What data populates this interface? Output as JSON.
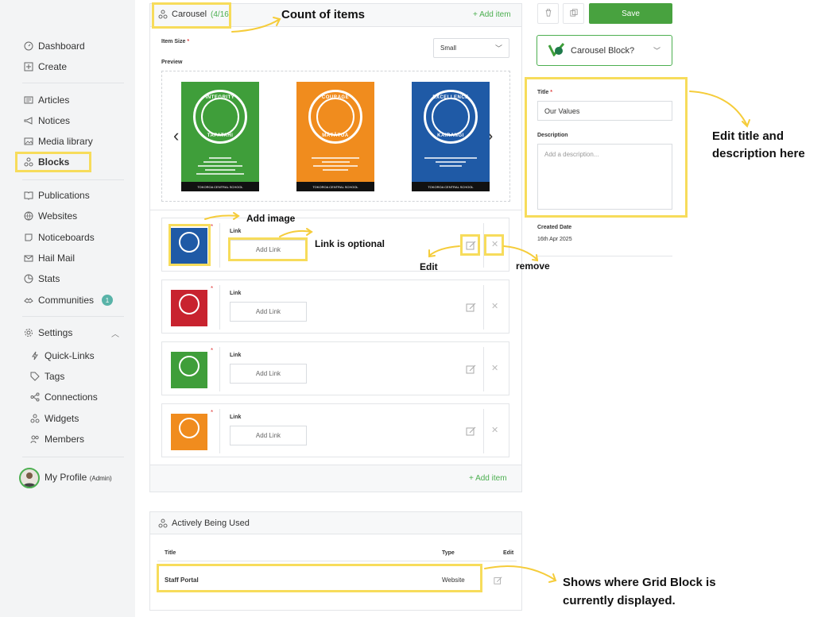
{
  "sidebar": {
    "items": [
      {
        "label": "Dashboard",
        "icon": "dashboard-icon"
      },
      {
        "label": "Create",
        "icon": "plus-square-icon"
      },
      {
        "label": "Articles",
        "icon": "newspaper-icon"
      },
      {
        "label": "Notices",
        "icon": "megaphone-icon"
      },
      {
        "label": "Media library",
        "icon": "image-icon"
      },
      {
        "label": "Blocks",
        "icon": "blocks-icon"
      },
      {
        "label": "Publications",
        "icon": "book-icon"
      },
      {
        "label": "Websites",
        "icon": "globe-icon"
      },
      {
        "label": "Noticeboards",
        "icon": "noticeboard-icon"
      },
      {
        "label": "Hail Mail",
        "icon": "mail-icon"
      },
      {
        "label": "Stats",
        "icon": "chart-icon"
      },
      {
        "label": "Communities",
        "icon": "communities-icon",
        "badge": "1"
      },
      {
        "label": "Settings",
        "icon": "gear-icon"
      },
      {
        "label": "Quick-Links",
        "icon": "lightning-icon"
      },
      {
        "label": "Tags",
        "icon": "tag-icon"
      },
      {
        "label": "Connections",
        "icon": "share-icon"
      },
      {
        "label": "Widgets",
        "icon": "widgets-icon"
      },
      {
        "label": "Members",
        "icon": "users-icon"
      }
    ],
    "profile": {
      "label": "My Profile",
      "role": "(Admin)"
    }
  },
  "carousel": {
    "title": "Carousel",
    "count": "(4/16",
    "add_item": "+ Add item",
    "item_size_label": "Item Size",
    "item_size_value": "Small",
    "preview_label": "Preview",
    "posters": [
      {
        "word_top": "INTEGRITY",
        "word_bot": "TAPATAHI",
        "color": "#3f9e3a",
        "foot": "TOKOROA CENTRAL SCHOOL"
      },
      {
        "word_top": "COURAGE",
        "word_bot": "MĀTĀTOA",
        "color": "#f08c1e",
        "foot": "TOKOROA CENTRAL SCHOOL"
      },
      {
        "word_top": "EXCELLENCE",
        "word_bot": "KAIRANGI",
        "color": "#1f5aa6",
        "foot": "TOKOROA CENTRAL SCHOOL"
      }
    ],
    "items": [
      {
        "color": "#1f5aa6",
        "link_label": "Link",
        "link_button": "Add Link"
      },
      {
        "color": "#c8232f",
        "link_label": "Link",
        "link_button": "Add Link"
      },
      {
        "color": "#3f9e3a",
        "link_label": "Link",
        "link_button": "Add Link"
      },
      {
        "color": "#f08c1e",
        "link_label": "Link",
        "link_button": "Add Link"
      }
    ],
    "add_item_bottom": "+ Add item"
  },
  "usage": {
    "title": "Actively Being Used",
    "columns": {
      "title": "Title",
      "type": "Type",
      "edit": "Edit"
    },
    "rows": [
      {
        "title": "Staff Portal",
        "type": "Website"
      }
    ]
  },
  "right": {
    "save_label": "Save",
    "block_type": "Carousel Block?",
    "title_label": "Title",
    "title_value": "Our Values",
    "description_label": "Description",
    "description_placeholder": "Add a description...",
    "created_label": "Created Date",
    "created_value": "16th Apr 2025"
  },
  "annotations": {
    "count": "Count of items",
    "add_image": "Add image",
    "link_optional": "Link is optional",
    "edit": "Edit",
    "remove": "remove",
    "edit_title_1": "Edit title and",
    "edit_title_2": "description here",
    "shows_1": "Shows where Grid Block is",
    "shows_2": "currently displayed."
  },
  "colors": {
    "accent": "#4caf50",
    "save": "#48a23f",
    "highlight": "#f7dc5b"
  }
}
